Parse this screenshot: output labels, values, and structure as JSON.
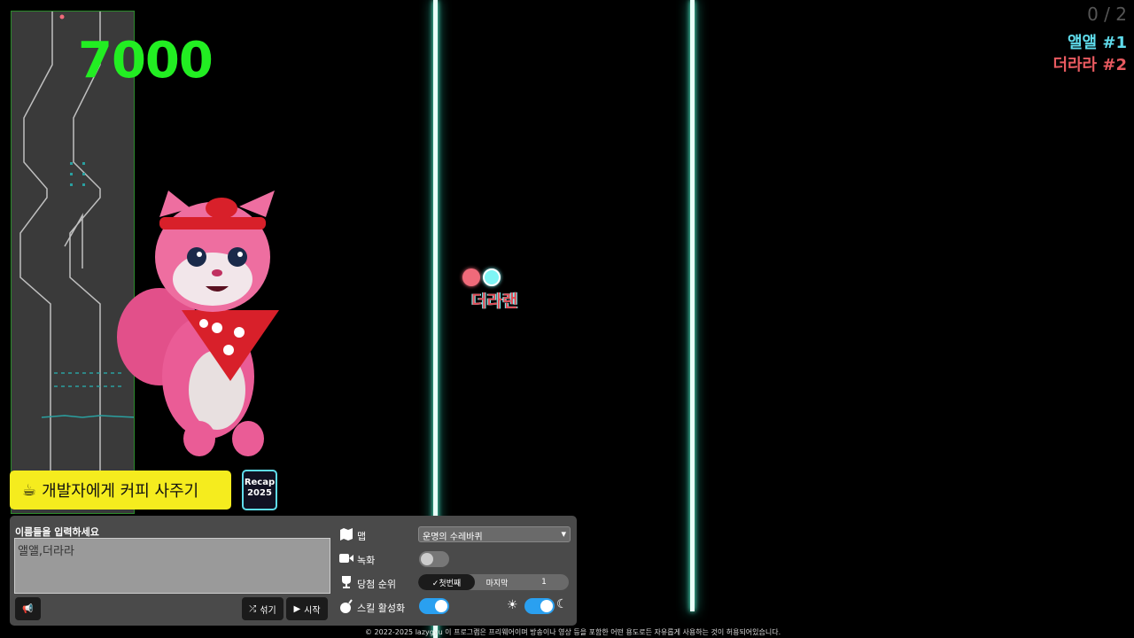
{
  "score": "7000",
  "ranking": {
    "counter": "0 / 2",
    "entries": [
      {
        "label": "앨앨 #1",
        "color": "#5fdcec"
      },
      {
        "label": "더라라 #2",
        "color": "#e85a60"
      }
    ]
  },
  "marbles": {
    "label": "더라랜"
  },
  "coffee_button": "개발자에게 커피 사주기",
  "recap": {
    "line1": "Recap",
    "line2": "2025"
  },
  "panel": {
    "names_label": "이름들을 입력하세요",
    "names_value": "앨앨,더라라",
    "shuffle_label": "섞기",
    "start_label": "시작",
    "map_label": "맵",
    "map_value": "운명의 수레바퀴",
    "record_label": "녹화",
    "winner_label": "당첨 순위",
    "winner_first": "✓첫번째",
    "winner_last": "마지막",
    "winner_num": "1",
    "skill_label": "스킬 활성화"
  },
  "footer": "© 2022-2025 lazygyu 이 프로그램은 프리웨어이며 방송이나 영상 등을 포함한 어떤 용도로든 자유롭게 사용하는 것이 허용되어있습니다.",
  "colors": {
    "score": "#22ee22",
    "accent": "#2aa0f0",
    "coffee": "#f5ec1e",
    "wall": "#5fffd8"
  }
}
